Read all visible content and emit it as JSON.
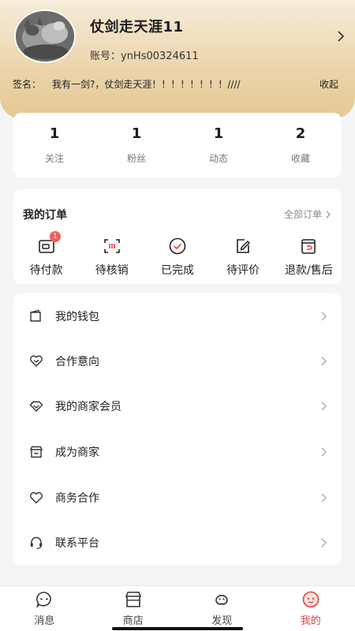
{
  "profile": {
    "username": "仗剑走天涯11",
    "account": "账号：ynHs00324611",
    "signature_label": "签名：",
    "signature_text": "我有一剑?，仗剑走天涯！！！！！！！！////",
    "collapse": "收起"
  },
  "stats": [
    {
      "count": "1",
      "label": "关注"
    },
    {
      "count": "1",
      "label": "粉丝"
    },
    {
      "count": "1",
      "label": "动态"
    },
    {
      "count": "2",
      "label": "收藏"
    }
  ],
  "orders": {
    "title": "我的订单",
    "all": "全部订单",
    "items": [
      {
        "label": "待付款",
        "icon": "pending-payment-icon",
        "badge": "1"
      },
      {
        "label": "待核销",
        "icon": "pending-verify-icon"
      },
      {
        "label": "已完成",
        "icon": "completed-icon"
      },
      {
        "label": "待评价",
        "icon": "pending-review-icon"
      },
      {
        "label": "退款/售后",
        "icon": "refund-icon"
      }
    ]
  },
  "menu": [
    {
      "label": "我的钱包",
      "icon": "wallet-icon"
    },
    {
      "label": "合作意向",
      "icon": "handshake-icon"
    },
    {
      "label": "我的商家会员",
      "icon": "diamond-icon"
    },
    {
      "label": "成为商家",
      "icon": "store-icon"
    },
    {
      "label": "商务合作",
      "icon": "heart-icon"
    },
    {
      "label": "联系平台",
      "icon": "headset-icon"
    }
  ],
  "tabbar": [
    {
      "label": "消息",
      "icon": "message-icon",
      "active": false
    },
    {
      "label": "商店",
      "icon": "shop-icon",
      "active": false
    },
    {
      "label": "发现",
      "icon": "discover-icon",
      "active": false
    },
    {
      "label": "我的",
      "icon": "profile-icon",
      "active": true
    }
  ],
  "colors": {
    "accent": "#e0423e",
    "header_gradient_top": "#f6ecd9",
    "header_gradient_bottom": "#e5c894"
  }
}
